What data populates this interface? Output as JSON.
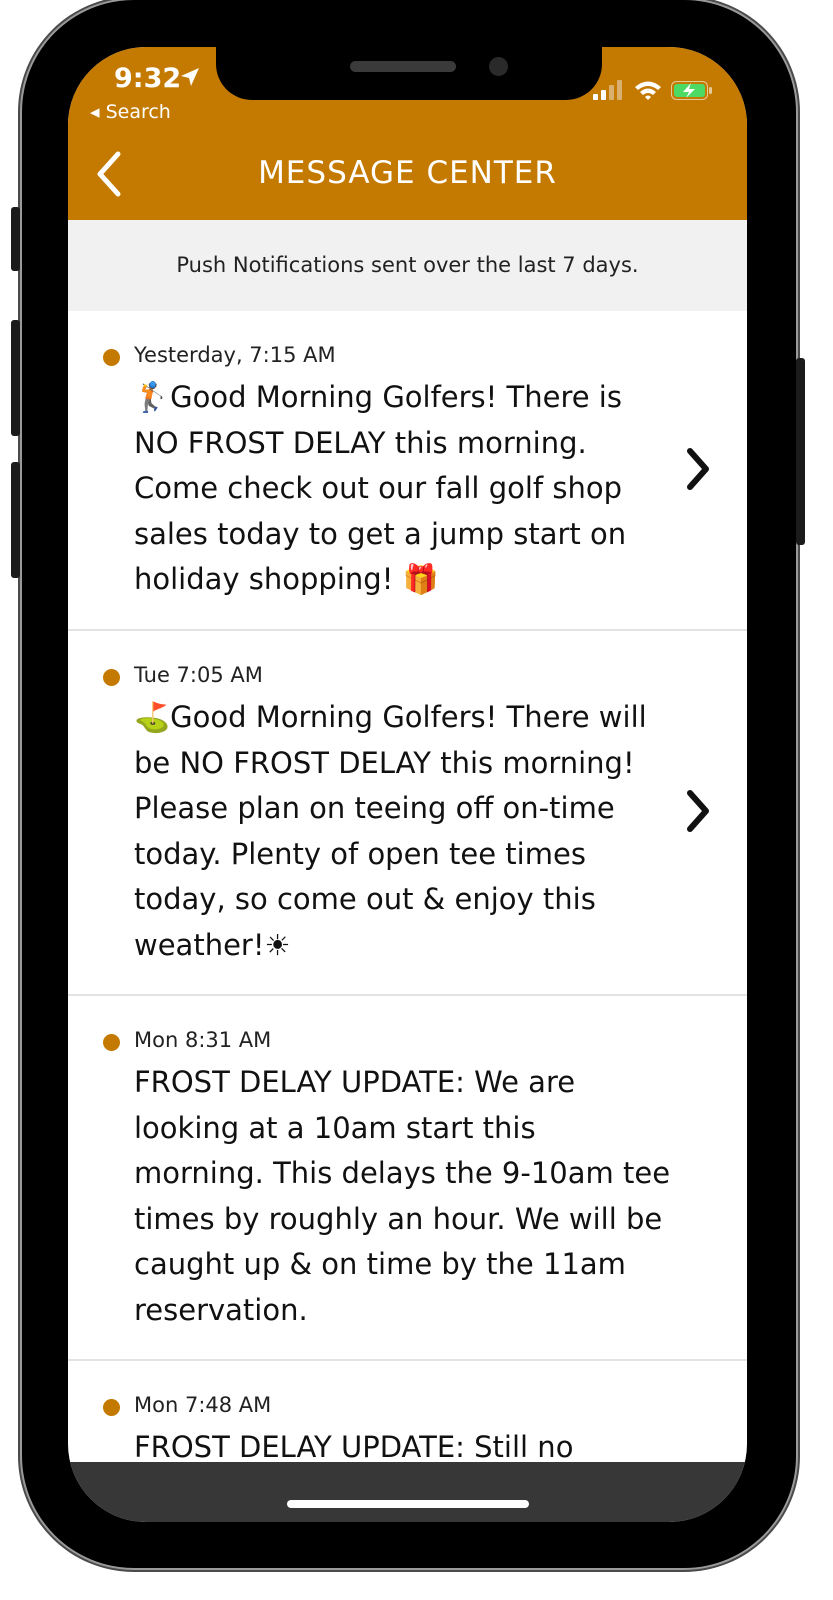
{
  "status_bar": {
    "time": "9:32",
    "back_app_label": "◂ Search"
  },
  "header": {
    "title": "MESSAGE CENTER"
  },
  "subheader": {
    "text": "Push Notifications sent over the last 7 days."
  },
  "messages": [
    {
      "timestamp": "Yesterday, 7:15 AM",
      "lead_emoji": "🏌",
      "text": "Good Morning Golfers! There is NO FROST DELAY this morning. Come check out our fall golf shop sales today to get a jump start on holiday shopping! ",
      "trail_emoji": "🎁"
    },
    {
      "timestamp": "Tue 7:05 AM",
      "lead_emoji": "⛳",
      "text": "Good Morning Golfers! There will be NO FROST DELAY this morning! Please plan on teeing off on-time today. Plenty of open tee times today, so come out & enjoy this weather!",
      "trail_emoji": "☀"
    },
    {
      "timestamp": "Mon 8:31 AM",
      "lead_emoji": "",
      "text": "FROST DELAY UPDATE: We are looking at a 10am start this morning. This delays the 9-10am tee times by roughly an hour. We will be caught up & on time by the 11am reservation.",
      "trail_emoji": ""
    },
    {
      "timestamp": "Mon 7:48 AM",
      "lead_emoji": "",
      "text": "FROST DELAY UPDATE: Still no",
      "trail_emoji": ""
    }
  ],
  "colors": {
    "accent": "#c47a00",
    "subheader_bg": "#f1f1f1"
  },
  "icons": {
    "back": "chevron-left-icon",
    "row_disclosure": "chevron-right-icon",
    "location": "location-arrow-icon",
    "signal": "cellular-signal-icon",
    "wifi": "wifi-icon",
    "battery": "battery-charging-icon"
  }
}
